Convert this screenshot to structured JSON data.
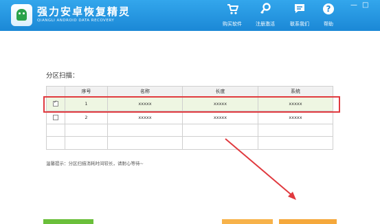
{
  "app": {
    "title": "强力安卓恢复精灵",
    "subtitle": "QIANGLI ANDROID DATA RECOVERY",
    "toolbar": [
      {
        "label": "购买软件",
        "icon": "cart-icon"
      },
      {
        "label": "注册激活",
        "icon": "key-icon"
      },
      {
        "label": "联系我们",
        "icon": "chat-icon"
      },
      {
        "label": "帮助",
        "icon": "help-icon"
      }
    ],
    "window_controls": {
      "minimize": "—",
      "close": "□"
    }
  },
  "main": {
    "section_label": "分区扫描：",
    "table": {
      "headers": [
        "",
        "序号",
        "名称",
        "长度",
        "系统"
      ],
      "rows": [
        {
          "checked": true,
          "index": "1",
          "name": "xxxxx",
          "length": "xxxxx",
          "system": "xxxxx"
        },
        {
          "checked": false,
          "index": "2",
          "name": "xxxxx",
          "length": "xxxxx",
          "system": "xxxxx"
        }
      ]
    },
    "tip": "温馨提示：分区扫描消耗时间较长，请耐心等待~"
  },
  "colors": {
    "accent": "#1b88d6",
    "highlight": "#e0393e",
    "green": "#6abf3a",
    "orange": "#f5a83b"
  }
}
